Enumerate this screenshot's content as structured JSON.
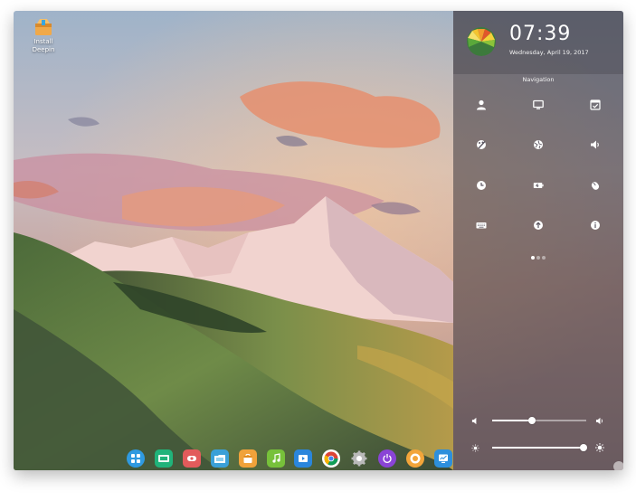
{
  "desktop": {
    "icons": [
      {
        "label": "Install Deepin",
        "icon": "installer-box-icon"
      }
    ]
  },
  "control_center": {
    "time": "07:39",
    "date": "Wednesday, April 19, 2017",
    "section_title": "Navigation",
    "grid": [
      {
        "name": "accounts",
        "icon": "user-icon"
      },
      {
        "name": "display",
        "icon": "monitor-icon"
      },
      {
        "name": "default-applications",
        "icon": "checkbox-window-icon"
      },
      {
        "name": "personalization",
        "icon": "palette-icon"
      },
      {
        "name": "network",
        "icon": "network-globe-icon"
      },
      {
        "name": "sound",
        "icon": "speaker-icon"
      },
      {
        "name": "time-date",
        "icon": "clock-icon"
      },
      {
        "name": "power",
        "icon": "battery-icon"
      },
      {
        "name": "mouse",
        "icon": "mouse-icon"
      },
      {
        "name": "keyboard",
        "icon": "keyboard-icon"
      },
      {
        "name": "update",
        "icon": "arrow-up-circle-icon"
      },
      {
        "name": "system-info",
        "icon": "info-icon"
      }
    ],
    "pages": {
      "count": 3,
      "active": 1
    },
    "volume_level": 0.42,
    "brightness_level": 0.97
  },
  "dock": {
    "apps": [
      {
        "name": "launcher",
        "icon": "launcher-icon",
        "color": "#2f9ae0"
      },
      {
        "name": "multitasking",
        "icon": "workspace-icon",
        "color": "#20b37a"
      },
      {
        "name": "screen-recorder",
        "icon": "recorder-icon",
        "color": "#e25b5b"
      },
      {
        "name": "file-manager",
        "icon": "folder-icon",
        "color": "#3aa0d8"
      },
      {
        "name": "app-store",
        "icon": "store-bag-icon",
        "color": "#f0a23a"
      },
      {
        "name": "music",
        "icon": "music-note-icon",
        "color": "#77c13a"
      },
      {
        "name": "video",
        "icon": "film-icon",
        "color": "#2a86dc"
      },
      {
        "name": "chrome",
        "icon": "chrome-icon",
        "color": "#e34c3b"
      },
      {
        "name": "settings",
        "icon": "gear-icon",
        "color": "#8a8a8a"
      },
      {
        "name": "shutdown",
        "icon": "power-icon",
        "color": "#8a44d6"
      },
      {
        "name": "photo-viewer",
        "icon": "photo-icon",
        "color": "#f3a53a"
      },
      {
        "name": "system-monitor",
        "icon": "monitor-chart-icon",
        "color": "#2d8fdc"
      }
    ]
  }
}
